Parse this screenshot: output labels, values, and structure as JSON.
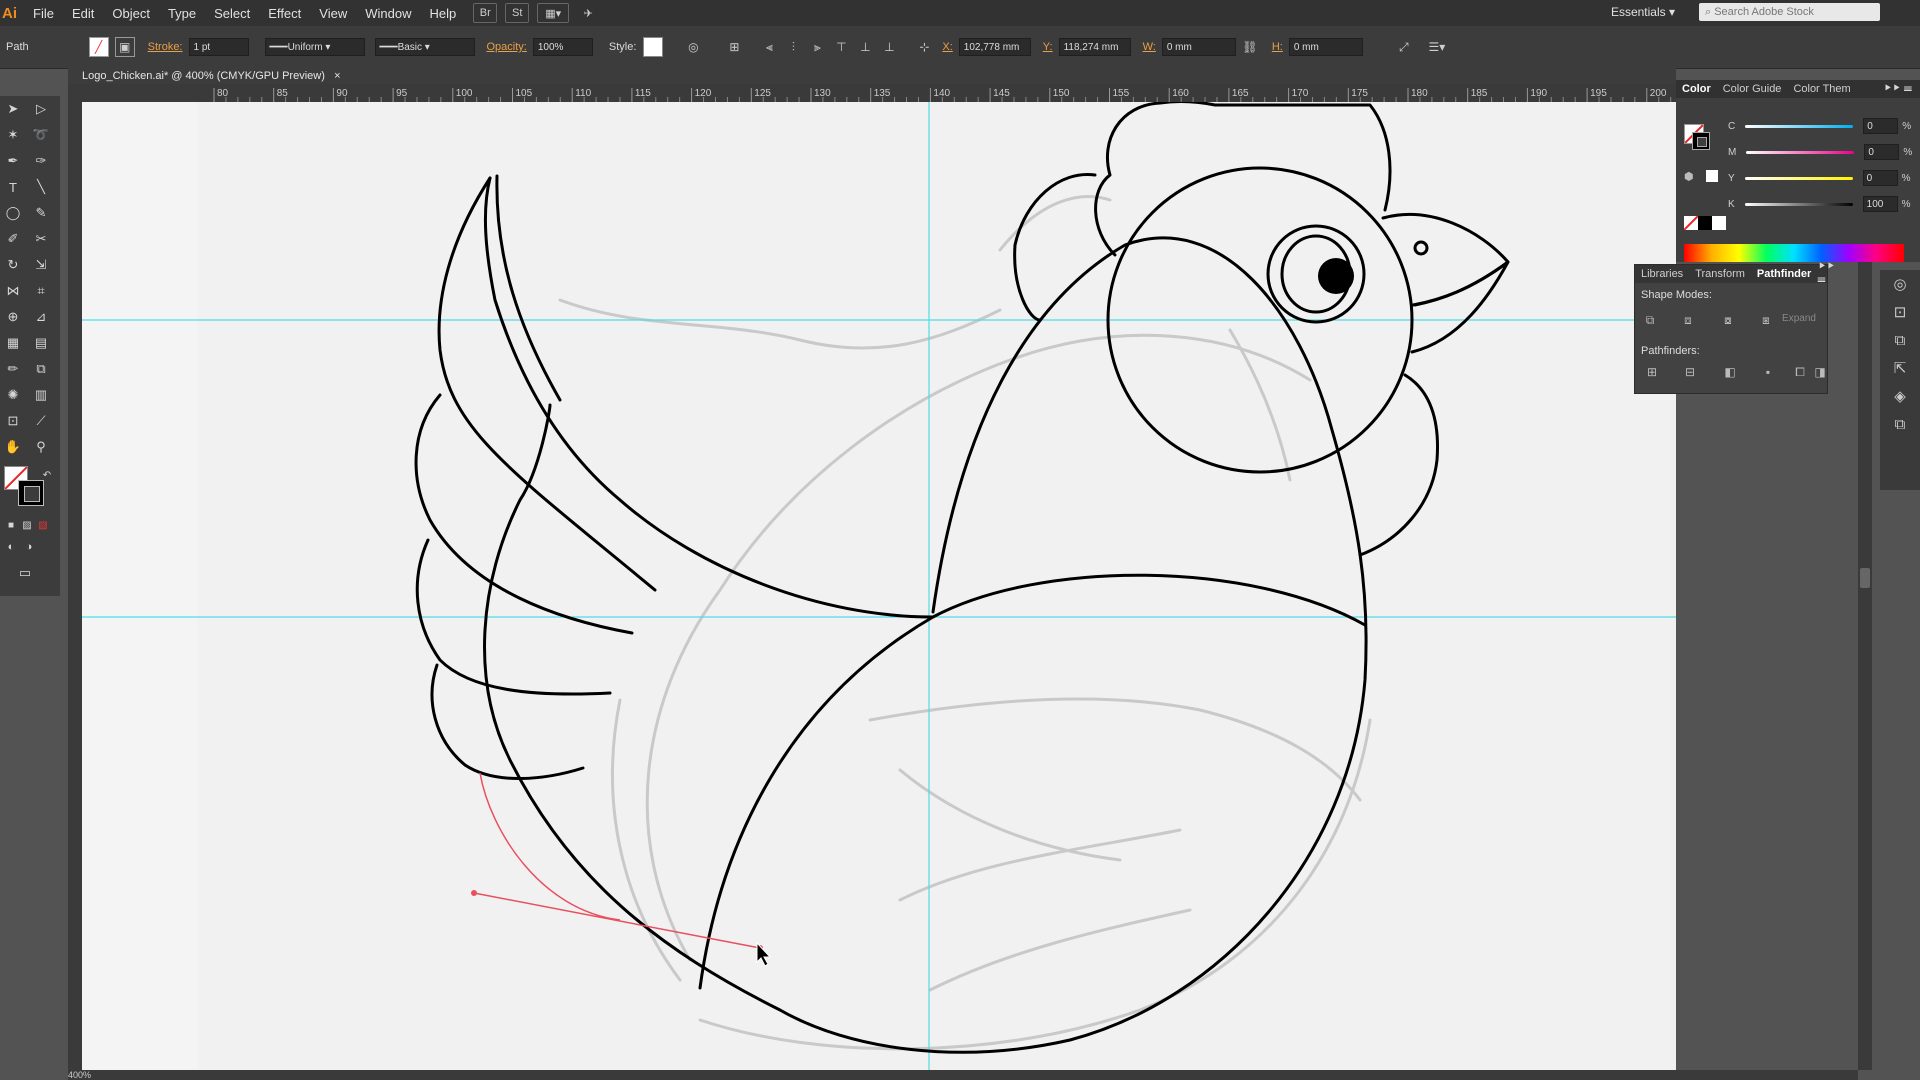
{
  "menu": [
    "File",
    "Edit",
    "Object",
    "Type",
    "Select",
    "Effect",
    "View",
    "Window",
    "Help"
  ],
  "app_logo": "Ai",
  "bridge_btn": "Br",
  "stock_btn": "St",
  "workspace": "Essentials",
  "stock_search_placeholder": "Search Adobe Stock",
  "control": {
    "selection_type": "Path",
    "stroke_label": "Stroke:",
    "stroke_value": "1 pt",
    "profile": "Uniform",
    "brush": "Basic",
    "opacity_label": "Opacity:",
    "opacity_value": "100%",
    "style_label": "Style:",
    "x_label": "X:",
    "x_value": "102,778 mm",
    "y_label": "Y:",
    "y_value": "118,274 mm",
    "w_label": "W:",
    "w_value": "0 mm",
    "h_label": "H:",
    "h_value": "0 mm"
  },
  "document_tab": "Logo_Chicken.ai* @ 400% (CMYK/GPU Preview)",
  "ruler_ticks": [
    "80",
    "85",
    "90",
    "95",
    "100",
    "105",
    "110",
    "115",
    "120",
    "125",
    "130",
    "135",
    "140",
    "145",
    "150",
    "155",
    "160",
    "165",
    "170",
    "175",
    "180",
    "185",
    "190",
    "195",
    "200"
  ],
  "color_panel": {
    "tabs": [
      "Color",
      "Color Guide",
      "Color Them"
    ],
    "rows": [
      {
        "label": "C",
        "value": "0"
      },
      {
        "label": "M",
        "value": "0"
      },
      {
        "label": "Y",
        "value": "0"
      },
      {
        "label": "K",
        "value": "100"
      }
    ],
    "unit": "%"
  },
  "pathfinder_panel": {
    "tabs": [
      "Libraries",
      "Transform",
      "Pathfinder"
    ],
    "shape_modes": "Shape Modes:",
    "expand": "Expand",
    "pathfinders": "Pathfinders:"
  },
  "zoom_status": "400%",
  "colors": {
    "accent_orange": "#f08c1e",
    "guide_cyan": "#4fdde6",
    "pen_preview": "#e8505f"
  }
}
